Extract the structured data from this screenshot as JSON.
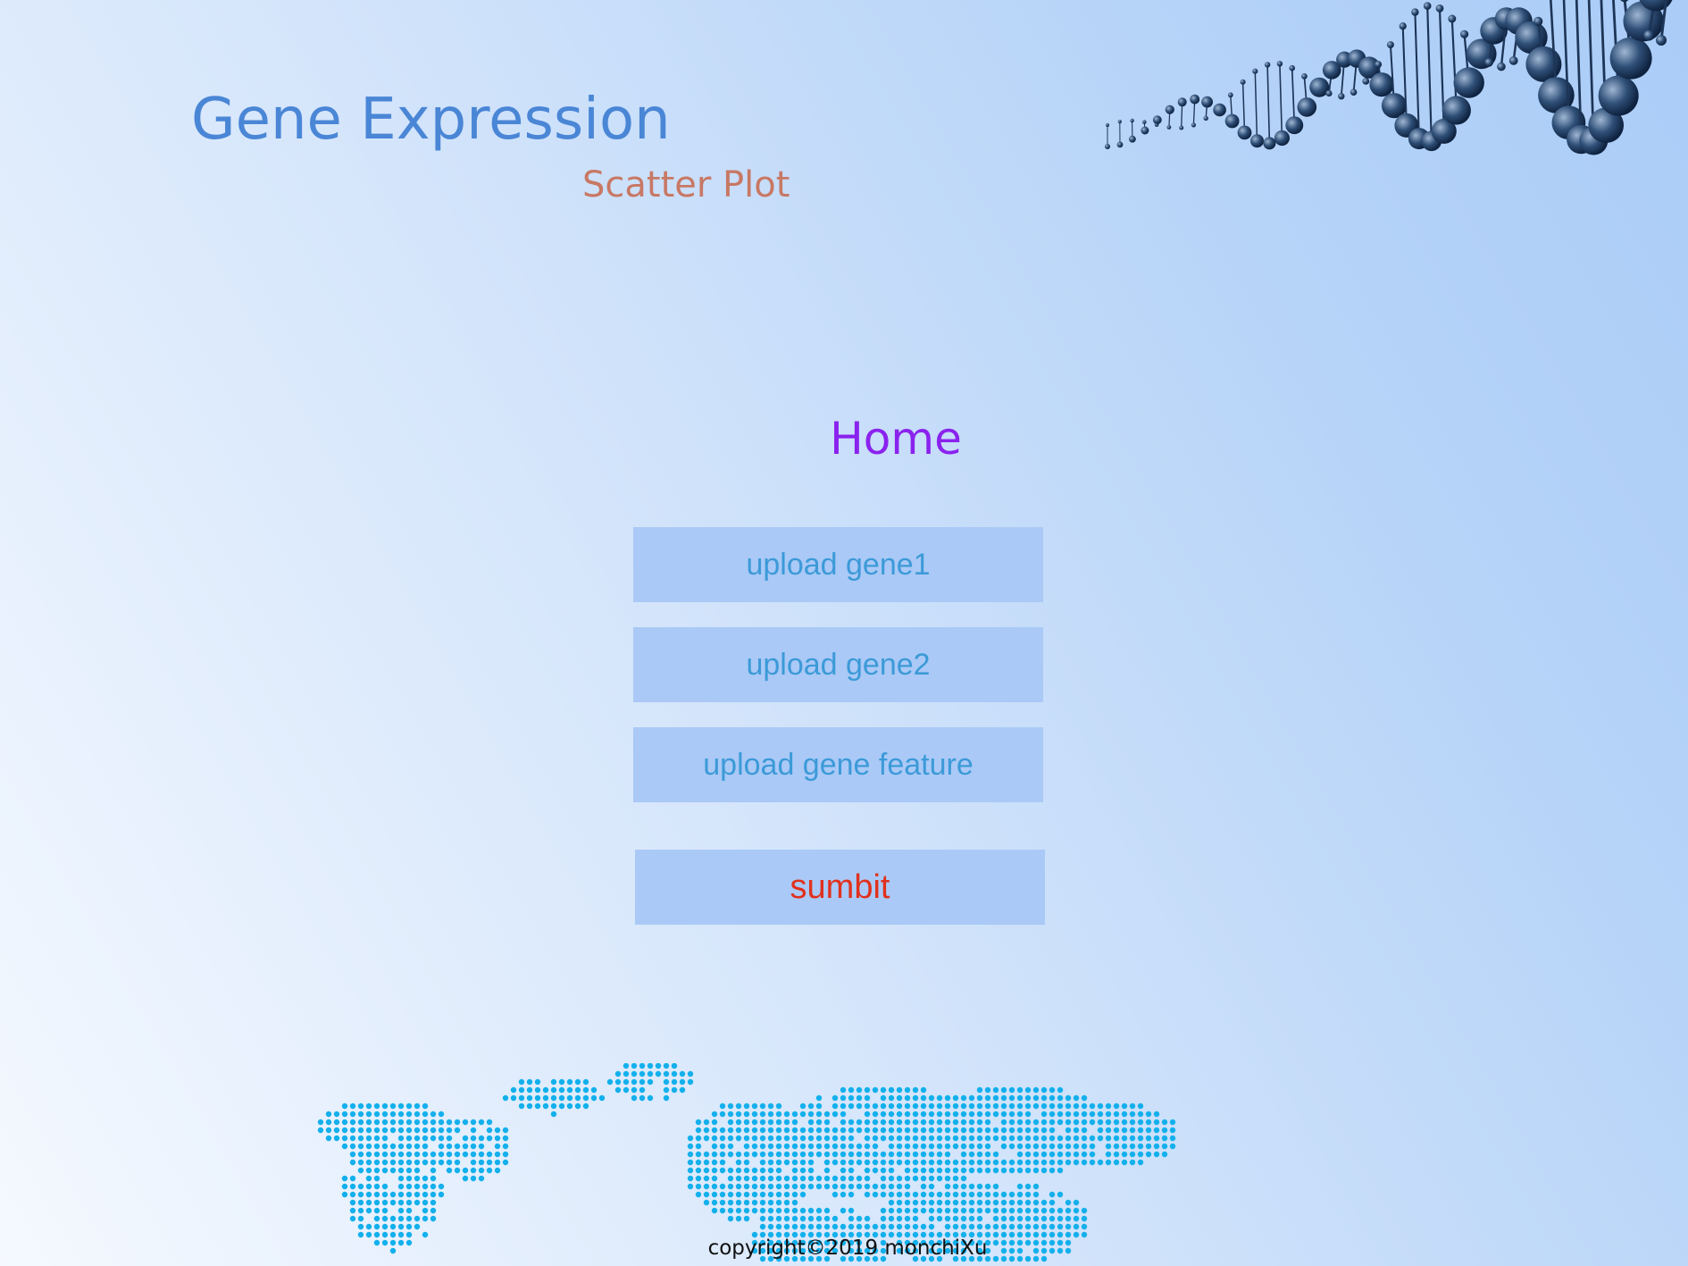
{
  "header": {
    "title": "Gene Expression",
    "subtitle": "Scatter Plot"
  },
  "main": {
    "heading": "Home",
    "buttons": {
      "upload_gene1": "upload gene1",
      "upload_gene2": "upload gene2",
      "upload_feature": "upload gene feature",
      "submit": "sumbit"
    }
  },
  "footer": {
    "copyright": "copyright©2019 monchiXu"
  },
  "decor": {
    "dna_icon": "dna-helix-image",
    "map_icon": "dotted-world-map-image"
  },
  "colors": {
    "title": "#4a86d6",
    "subtitle": "#c87864",
    "heading": "#8a22ee",
    "button_bg": "#aac9f6",
    "button_text": "#3c9ad8",
    "submit_text": "#e1301c",
    "map_dots": "#12b0ec"
  }
}
